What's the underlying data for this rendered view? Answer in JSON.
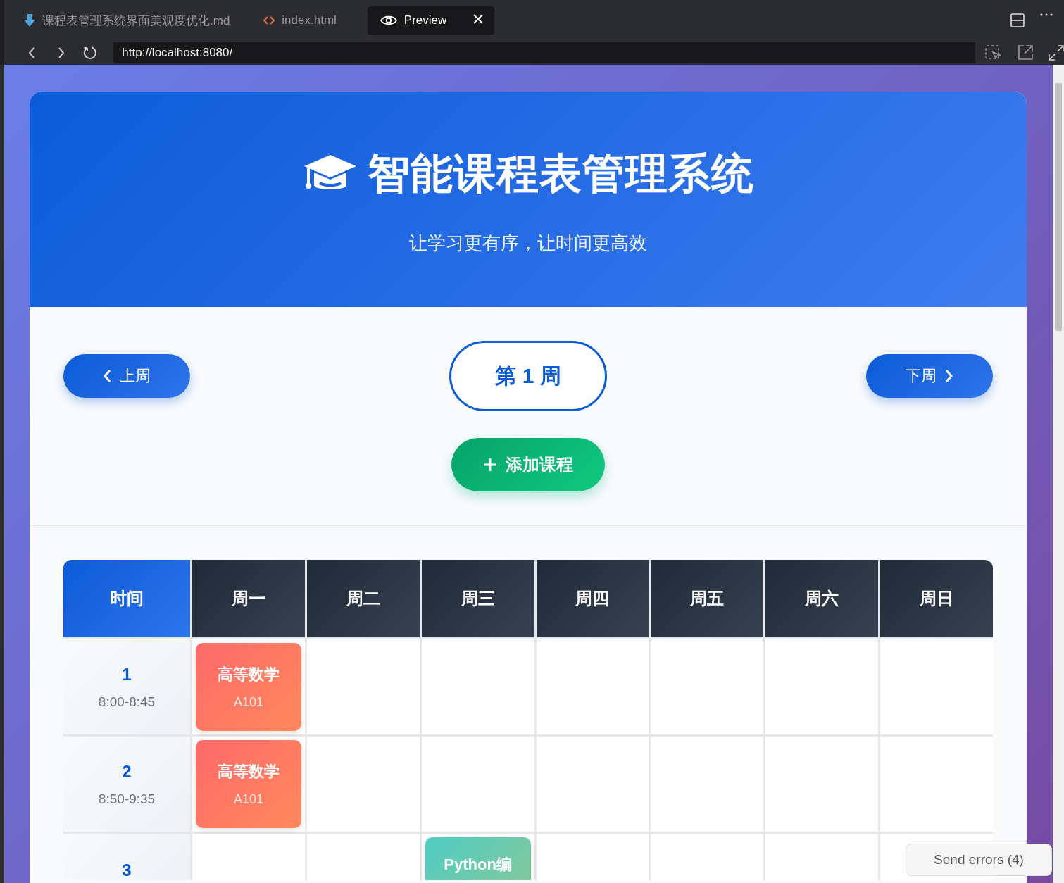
{
  "editor_tabs": [
    {
      "kind": "markdown",
      "label": "课程表管理系统界面美观度优化.md",
      "selected": false
    },
    {
      "kind": "code",
      "label": "index.html",
      "selected": false
    },
    {
      "kind": "preview",
      "label": "Preview",
      "selected": true
    }
  ],
  "address_bar": {
    "url": "http://localhost:8080/"
  },
  "header": {
    "title": "智能课程表管理系统",
    "subtitle": "让学习更有序，让时间更高效"
  },
  "week_nav": {
    "prev": "上周",
    "current": "第 1 周",
    "next": "下周"
  },
  "add_button": "添加课程",
  "timetable": {
    "columns": [
      "时间",
      "周一",
      "周二",
      "周三",
      "周四",
      "周五",
      "周六",
      "周日"
    ],
    "rows": [
      {
        "cells": [
          {
            "kind": "time",
            "period": "1",
            "time": "8:00-8:45"
          },
          {
            "kind": "course",
            "name": "高等数学",
            "room": "A101",
            "color": "#ff6b6b"
          },
          {
            "kind": "empty"
          },
          {
            "kind": "empty"
          },
          {
            "kind": "empty"
          },
          {
            "kind": "empty"
          },
          {
            "kind": "empty"
          },
          {
            "kind": "empty"
          }
        ]
      },
      {
        "cells": [
          {
            "kind": "time",
            "period": "2",
            "time": "8:50-9:35"
          },
          {
            "kind": "course",
            "name": "高等数学",
            "room": "A101",
            "color": "#ff6b6b"
          },
          {
            "kind": "empty"
          },
          {
            "kind": "empty"
          },
          {
            "kind": "empty"
          },
          {
            "kind": "empty"
          },
          {
            "kind": "empty"
          },
          {
            "kind": "empty"
          }
        ]
      },
      {
        "cells": [
          {
            "kind": "time",
            "period": "3"
          },
          {
            "kind": "empty"
          },
          {
            "kind": "empty"
          },
          {
            "kind": "course",
            "name": "Python编",
            "color": "#4ecdc4"
          },
          {
            "kind": "empty"
          },
          {
            "kind": "empty"
          },
          {
            "kind": "empty"
          },
          {
            "kind": "empty"
          }
        ]
      }
    ]
  },
  "error_popup": {
    "label": "Send errors (4)"
  }
}
